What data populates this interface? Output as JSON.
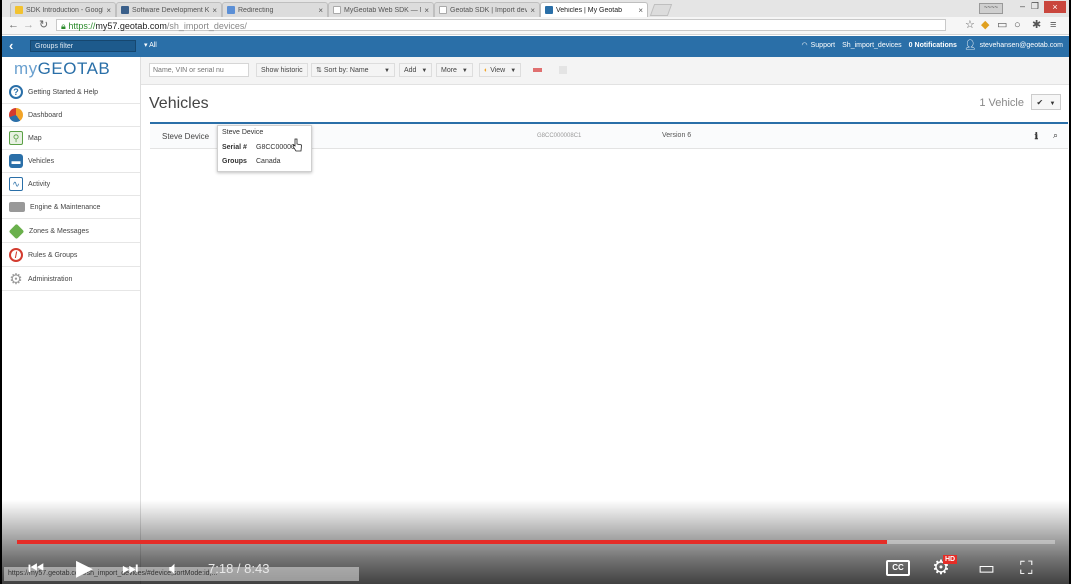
{
  "browser": {
    "tabs": [
      {
        "label": "SDK Introduction - Googl",
        "color": "#f2c230",
        "active": false
      },
      {
        "label": "Software Development K",
        "color": "#3a5f8a",
        "active": false
      },
      {
        "label": "Redirecting",
        "color": "#5b8fd6",
        "active": false
      },
      {
        "label": "MyGeotab Web SDK — M",
        "color": "#bbbbbb",
        "active": false
      },
      {
        "label": "Geotab SDK | Import dev",
        "color": "#bbbbbb",
        "active": false
      },
      {
        "label": "Vehicles | My Geotab",
        "color": "#2a6fa8",
        "active": true
      }
    ],
    "user_badge": "~~~~",
    "url_scheme": "https://",
    "url_host": "my57.geotab.com",
    "url_path": "/sh_import_devices/"
  },
  "topbar": {
    "groups_filter": "Groups filter",
    "all_label": "All",
    "support": "Support",
    "database": "Sh_import_devices",
    "notifications": "0 Notifications",
    "user": "stevehansen@geotab.com"
  },
  "sidebar": {
    "logo_my": "my",
    "logo_geotab": "GEOTAB",
    "items": [
      {
        "label": "Getting Started & Help",
        "icon": "help-icon",
        "color": "#2a6fa8"
      },
      {
        "label": "Dashboard",
        "icon": "dashboard-icon",
        "color": "#f2a428"
      },
      {
        "label": "Map",
        "icon": "map-icon",
        "color": "#5aa045"
      },
      {
        "label": "Vehicles",
        "icon": "vehicle-icon",
        "color": "#2a6fa8"
      },
      {
        "label": "Activity",
        "icon": "activity-icon",
        "color": "#2a6fa8"
      },
      {
        "label": "Engine & Maintenance",
        "icon": "engine-icon",
        "color": "#888888"
      },
      {
        "label": "Zones & Messages",
        "icon": "zones-icon",
        "color": "#6ab04c"
      },
      {
        "label": "Rules & Groups",
        "icon": "rules-icon",
        "color": "#d33b2f"
      },
      {
        "label": "Administration",
        "icon": "gear-icon",
        "color": "#999999"
      }
    ]
  },
  "toolbar": {
    "search_placeholder": "Name, VIN or serial nu",
    "show_historic": "Show historic",
    "sort_by": "Sort by: Name",
    "add": "Add",
    "more": "More",
    "view": "View"
  },
  "main": {
    "title": "Vehicles",
    "count": "1 Vehicle",
    "rows": [
      {
        "name": "Steve Device",
        "serial": "G8CC000008C1",
        "version": "Version 6"
      }
    ],
    "tooltip": {
      "title": "Steve Device",
      "serial_label": "Serial #",
      "serial_value": "G8CC00000",
      "groups_label": "Groups",
      "groups_value": "Canada"
    }
  },
  "player": {
    "current_time": "7:18",
    "duration": "8:43",
    "time_display": "7:18 / 8:43",
    "played_fraction": 0.838,
    "cc": "CC",
    "hd": "HD",
    "status_text": "https://my57.geotab.com/sh_import_devices/#device,sortMode:id,..."
  }
}
